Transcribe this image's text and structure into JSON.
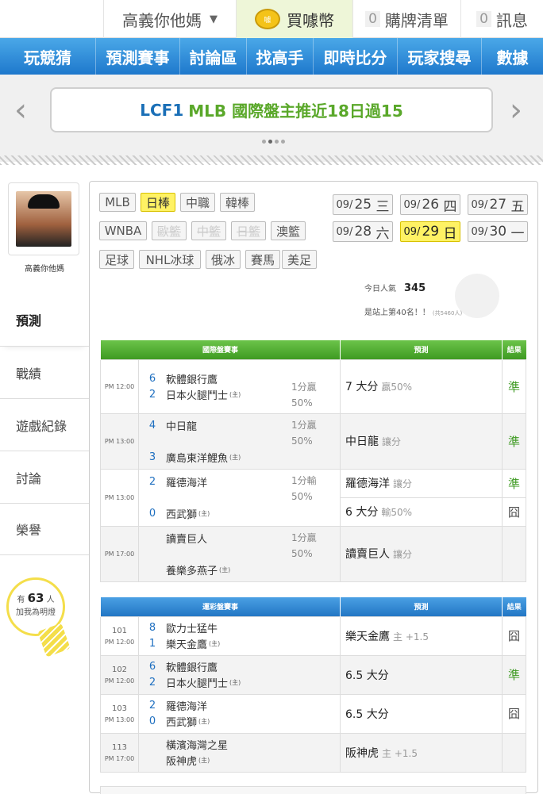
{
  "topbar": {
    "user": "高義你他媽",
    "buy": "買噱幣",
    "coin_text": "噱",
    "cart_count": "0",
    "cart": "購牌清單",
    "msg_count": "0",
    "msg": "訊息"
  },
  "nav": [
    "玩競猜",
    "預測賽事",
    "討論區",
    "找高手",
    "即時比分",
    "玩家搜尋",
    "數據"
  ],
  "banner": {
    "prefix": "LCF1",
    "text": "MLB 國際盤主推近18日過15"
  },
  "sidebar": {
    "username": "高義你他媽",
    "active": "預測",
    "items": [
      "戰績",
      "遊戲紀錄",
      "討論",
      "榮譽"
    ],
    "fans_pre": "有",
    "fans_count": "63",
    "fans_unit": "人",
    "fans_sub": "加我為明燈"
  },
  "tags": {
    "row1": [
      "MLB",
      "日棒",
      "中職",
      "韓棒"
    ],
    "row2": [
      "WNBA",
      "歐籃",
      "中籃",
      "日籃",
      "澳籃"
    ],
    "row3": [
      "足球",
      "NHL冰球",
      "俄冰",
      "賽馬",
      "美足"
    ],
    "selected": "日棒"
  },
  "dates": [
    {
      "d": "09/",
      "n": "25",
      "w": "三"
    },
    {
      "d": "09/",
      "n": "26",
      "w": "四"
    },
    {
      "d": "09/",
      "n": "27",
      "w": "五"
    },
    {
      "d": "09/",
      "n": "28",
      "w": "六"
    },
    {
      "d": "09/",
      "n": "29",
      "w": "日"
    },
    {
      "d": "09/",
      "n": "30",
      "w": "一"
    }
  ],
  "stats": {
    "pop_label": "今日人氣",
    "pop_value": "345",
    "rank": "是站上第40名！！",
    "rank_small": "(共5460人)"
  },
  "intl": {
    "headers": [
      "國際盤賽事",
      "預測",
      "結果"
    ],
    "rows": [
      {
        "time": "PM 12:00",
        "s1": "6",
        "t1": "軟體銀行鷹",
        "s2": "2",
        "t2": "日本火腿鬥士",
        "host": "(主)",
        "hc1": "1分贏",
        "hc2": "50%",
        "pred": "7 大分",
        "note": "贏50%",
        "res": "準"
      },
      {
        "time": "PM 13:00",
        "s1": "4",
        "t1": "中日龍",
        "s2": "3",
        "t2": "廣島東洋鯉魚",
        "host": "(主)",
        "hc1": "1分贏",
        "hc2": "50%",
        "pred": "中日龍",
        "note": "讓分",
        "res": "準"
      },
      {
        "time": "PM 13:00",
        "s1": "2",
        "t1": "羅德海洋",
        "s2": "0",
        "t2": "西武獅",
        "host": "(主)",
        "hc1": "1分輸",
        "hc2": "50%",
        "pred": "羅德海洋",
        "note": "讓分",
        "res": "準",
        "pred2": "6 大分",
        "note2": "輸50%",
        "res2": "囧"
      },
      {
        "time": "PM 17:00",
        "s1": "",
        "t1": "讀賣巨人",
        "s2": "",
        "t2": "養樂多燕子",
        "host": "(主)",
        "hc1": "1分贏",
        "hc2": "50%",
        "pred": "讀賣巨人",
        "note": "讓分",
        "res": ""
      }
    ]
  },
  "lottery": {
    "headers": [
      "運彩盤賽事",
      "預測",
      "結果"
    ],
    "rows": [
      {
        "id": "101",
        "time": "PM 12:00",
        "s1": "8",
        "t1": "歐力士猛牛",
        "s2": "1",
        "t2": "樂天金鷹",
        "host": "(主)",
        "pred": "樂天金鷹",
        "note": "主 +1.5",
        "res": "囧"
      },
      {
        "id": "102",
        "time": "PM 12:00",
        "s1": "6",
        "t1": "軟體銀行鷹",
        "s2": "2",
        "t2": "日本火腿鬥士",
        "host": "(主)",
        "pred": "6.5 大分",
        "note": "",
        "res": "準"
      },
      {
        "id": "103",
        "time": "PM 13:00",
        "s1": "2",
        "t1": "羅德海洋",
        "s2": "0",
        "t2": "西武獅",
        "host": "(主)",
        "pred": "6.5 大分",
        "note": "",
        "res": "囧"
      },
      {
        "id": "113",
        "time": "PM 17:00",
        "s1": "",
        "t1": "橫濱海灣之星",
        "s2": "",
        "t2": "阪神虎",
        "host": "(主)",
        "pred": "阪神虎",
        "note": "主 +1.5",
        "res": ""
      }
    ]
  },
  "colors": {
    "nav": "#1e78cc",
    "green": "#3e9a22",
    "highlight": "#fff264"
  }
}
